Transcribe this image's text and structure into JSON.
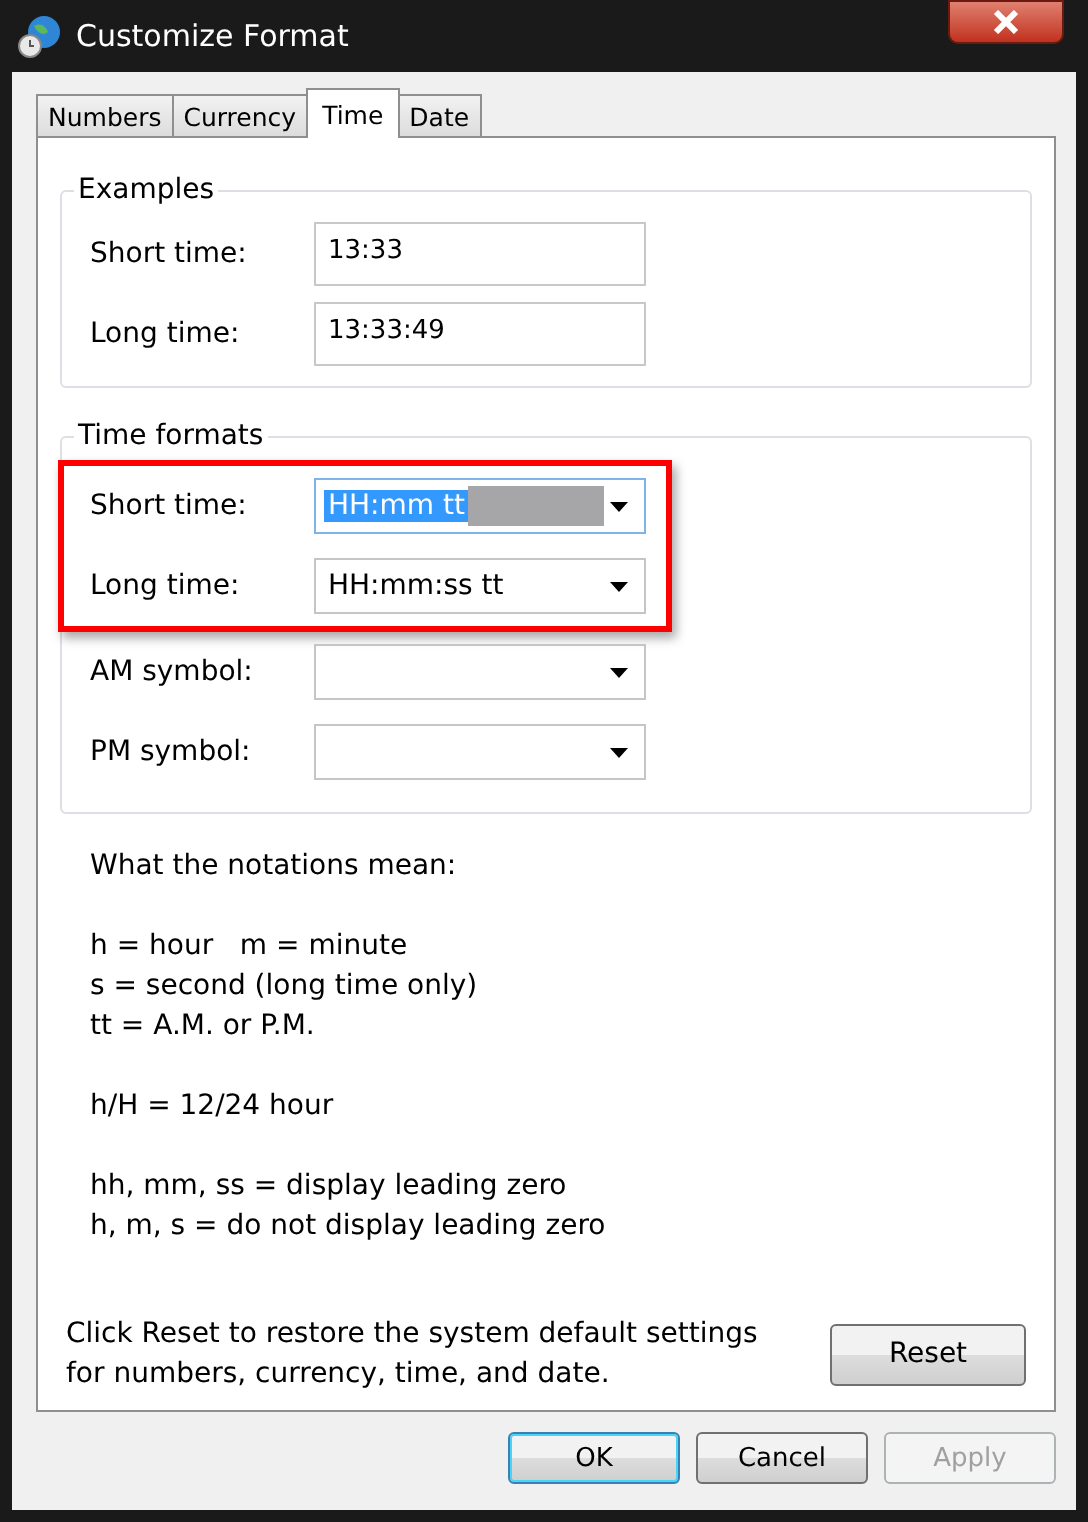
{
  "window": {
    "title": "Customize Format"
  },
  "tabs": [
    {
      "label": "Numbers",
      "selected": false
    },
    {
      "label": "Currency",
      "selected": false
    },
    {
      "label": "Time",
      "selected": true
    },
    {
      "label": "Date",
      "selected": false
    }
  ],
  "examples": {
    "title": "Examples",
    "rows": [
      {
        "label": "Short time:",
        "value": "13:33"
      },
      {
        "label": "Long time:",
        "value": "13:33:49"
      }
    ]
  },
  "time_formats": {
    "title": "Time formats",
    "highlighted_rows": [
      {
        "label": "Short time:",
        "value": "HH:mm tt",
        "text_selected": true
      },
      {
        "label": "Long time:",
        "value": "HH:mm:ss tt",
        "text_selected": false
      }
    ],
    "rows": [
      {
        "label": "AM symbol:",
        "value": "",
        "text_selected": false
      },
      {
        "label": "PM symbol:",
        "value": "",
        "text_selected": false
      }
    ]
  },
  "notations": [
    [
      "What the notations mean:"
    ],
    [
      "h = hour   m = minute",
      "s = second (long time only)",
      "tt = A.M. or P.M."
    ],
    [
      "h/H = 12/24 hour"
    ],
    [
      "hh, mm, ss = display leading zero",
      "h, m, s = do not display leading zero"
    ]
  ],
  "reset_note": "Click Reset to restore the system default settings for numbers, currency, time, and date.",
  "reset_button": "Reset",
  "buttons": [
    {
      "label": "OK",
      "kind": "default",
      "disabled": false
    },
    {
      "label": "Cancel",
      "kind": "normal",
      "disabled": false
    },
    {
      "label": "Apply",
      "kind": "normal",
      "disabled": true
    }
  ]
}
